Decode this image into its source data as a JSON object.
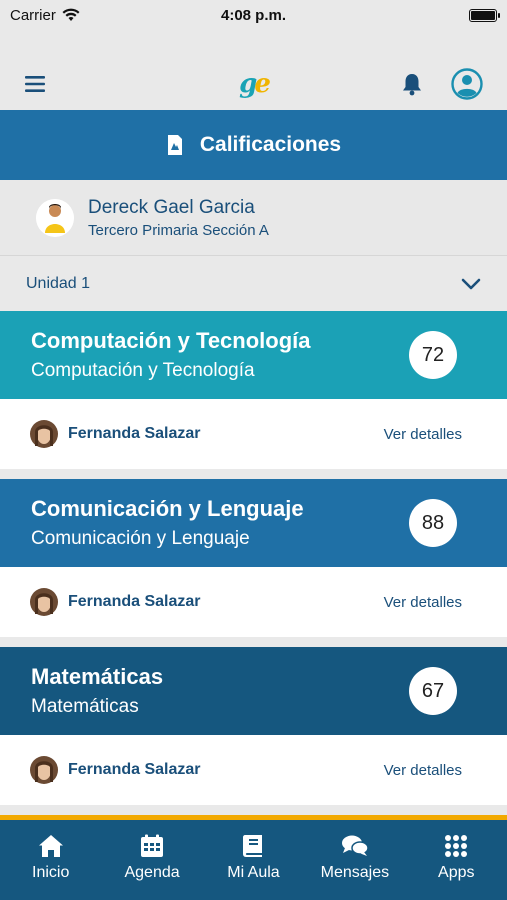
{
  "status_bar": {
    "carrier": "Carrier",
    "time": "4:08 p.m."
  },
  "header": {
    "logo": "ge"
  },
  "title_bar": {
    "title": "Calificaciones"
  },
  "student": {
    "name": "Dereck Gael Garcia",
    "class": "Tercero Primaria Sección A"
  },
  "unit_select": {
    "value": "Unidad 1"
  },
  "courses": [
    {
      "title": "Computación y Tecnología",
      "subtitle": "Computación y Tecnología",
      "grade": "72",
      "teacher": "Fernanda Salazar",
      "details": "Ver detalles",
      "color": "#1ba1b6"
    },
    {
      "title": "Comunicación y Lenguaje",
      "subtitle": "Comunicación y Lenguaje",
      "grade": "88",
      "teacher": "Fernanda Salazar",
      "details": "Ver detalles",
      "color": "#1f70a6"
    },
    {
      "title": "Matemáticas",
      "subtitle": "Matemáticas",
      "grade": "67",
      "teacher": "Fernanda Salazar",
      "details": "Ver detalles",
      "color": "#15577f"
    }
  ],
  "nav": [
    {
      "label": "Inicio",
      "icon": "home-icon"
    },
    {
      "label": "Agenda",
      "icon": "calendar-icon"
    },
    {
      "label": "Mi Aula",
      "icon": "book-icon"
    },
    {
      "label": "Mensajes",
      "icon": "chat-icon"
    },
    {
      "label": "Apps",
      "icon": "grid-icon"
    }
  ],
  "colors": {
    "accent": "#1f70a6",
    "nav_bg": "#15577f",
    "nav_border": "#f2a900",
    "text_dark": "#1a4f7a"
  }
}
